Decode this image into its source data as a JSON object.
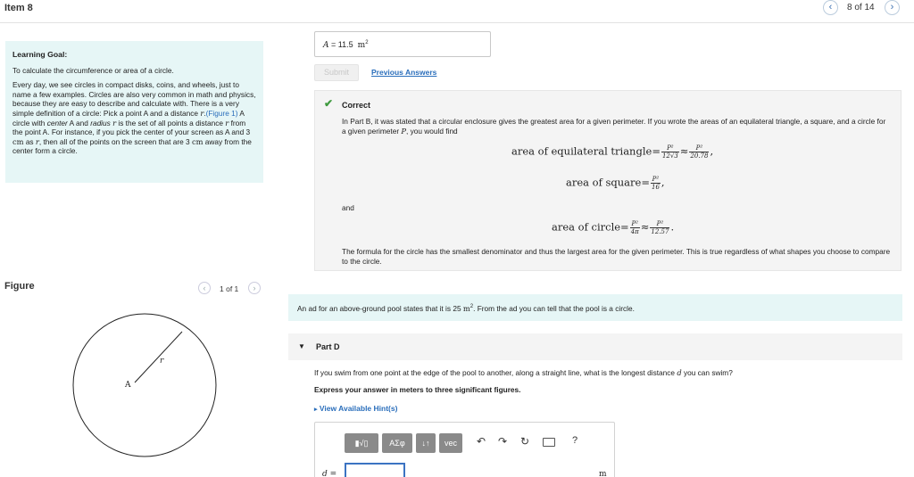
{
  "header": {
    "item_title": "Item 8",
    "item_counter": "8 of 14",
    "prev_icon": "chevron-left-icon",
    "next_icon": "chevron-right-icon"
  },
  "learning_goal": {
    "heading": "Learning Goal:",
    "intro": "To calculate the circumference or area of a circle.",
    "body_1": "Every day, we see circles in compact disks, coins, and wheels, just to name a few examples. Circles are also very common in math and physics, because they are easy to describe and calculate with. There is a very simple definition of a circle: Pick a point A and a distance ",
    "r": "r",
    "dot": ".",
    "figure_link": "(Figure 1)",
    "body_2": " A circle with ",
    "center_phrase": "center",
    "body_3": " A and ",
    "radius_phrase": "radius",
    "body_4": " is the set of all points a distance ",
    "body_5": " from the point A. For instance, if you pick the center of your screen as A and 3 ",
    "cm": "cm",
    "body_6": " as ",
    "body_7": ", then all of the points on the screen that are 3 ",
    "body_8": " away from the center form a circle."
  },
  "figure": {
    "label": "Figure",
    "counter": "1 of 1",
    "center_label": "A",
    "radius_label": "r"
  },
  "previous_answer": {
    "var": "A",
    "eq": " = ",
    "value": "11.5",
    "unit": "m",
    "unit_exp": "2"
  },
  "buttons": {
    "submit": "Submit",
    "previous_answers": "Previous Answers"
  },
  "feedback": {
    "status": "Correct",
    "text_1": "In Part B, it was stated that a circular enclosure gives the greatest area for a given perimeter. If you wrote the areas of an equilateral triangle, a square, and a circle for a given perimeter ",
    "P": "P",
    "text_2": ", you would find",
    "eq1_label": "area of equilateral triangle",
    "eq1_den1": "12√3",
    "eq1_den2": "20.78",
    "eq2_label": "area of square",
    "eq2_den": "16",
    "and": "and",
    "eq3_label": "area of circle",
    "eq3_den1": "4π",
    "eq3_den2": "12.57",
    "numerator": "P²",
    "equals": "=",
    "approx": "≈",
    "comma": ",",
    "period": ".",
    "conclusion": "The formula for the circle has the smallest denominator and thus the largest area for the given perimeter. This is true regardless of what shapes you choose to compare to the circle."
  },
  "ad_statement": {
    "text_1": "An ad for an above-ground pool states that it is 25 ",
    "unit": "m",
    "unit_exp": "2",
    "text_2": ". From the ad you can tell that the pool is a circle."
  },
  "part_d": {
    "title": "Part D",
    "question_1": "If you swim from one point at the edge of the pool to another, along a straight line, what is the longest distance ",
    "d": "d",
    "question_2": " you can swim?",
    "instruction": "Express your answer in meters to three significant figures.",
    "hints": "View Available Hint(s)"
  },
  "editor": {
    "templates": "▮√▯",
    "greek": "ΑΣφ",
    "sort": "↓↑",
    "vec": "vec",
    "undo": "↶",
    "redo": "↷",
    "reset": "↻",
    "help": "?",
    "var_label": "d =",
    "input_value": "",
    "unit": "m"
  }
}
